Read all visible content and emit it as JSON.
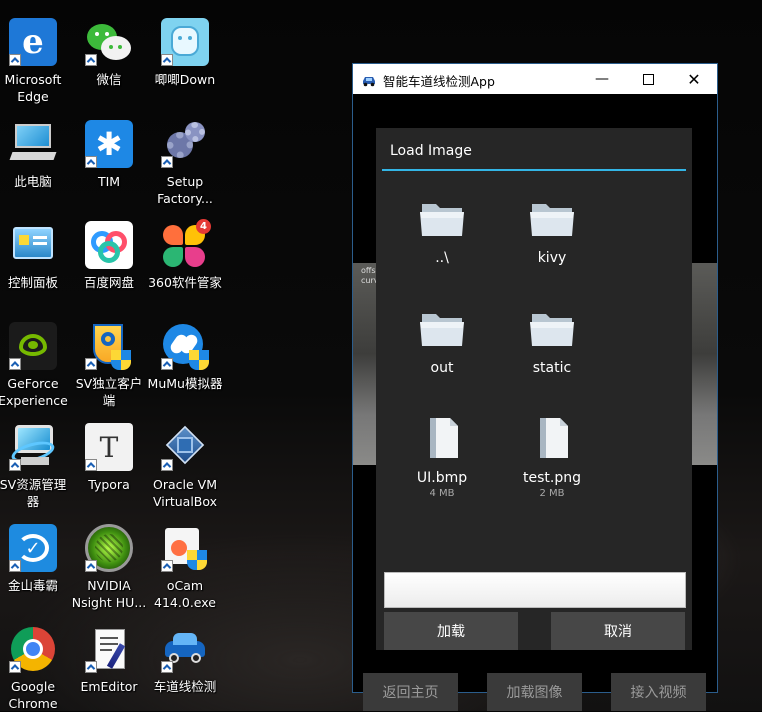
{
  "desktop": {
    "icons": [
      {
        "label": "Microsoft Edge",
        "icon": "edge-icon"
      },
      {
        "label": "微信",
        "icon": "wechat-icon"
      },
      {
        "label": "唧唧Down",
        "icon": "jijidown-icon"
      },
      {
        "label": "此电脑",
        "icon": "this-pc-icon"
      },
      {
        "label": "TIM",
        "icon": "tim-icon"
      },
      {
        "label": "Setup Factory...",
        "icon": "setup-factory-icon"
      },
      {
        "label": "控制面板",
        "icon": "control-panel-icon"
      },
      {
        "label": "百度网盘",
        "icon": "baidu-netdisk-icon"
      },
      {
        "label": "360软件管家",
        "icon": "360-software-icon",
        "badge": "4"
      },
      {
        "label": "GeForce Experience",
        "icon": "geforce-icon"
      },
      {
        "label": "SV独立客户端",
        "icon": "sv-client-icon"
      },
      {
        "label": "MuMu模拟器",
        "icon": "mumu-icon"
      },
      {
        "label": "SV资源管理器",
        "icon": "sv-explorer-icon"
      },
      {
        "label": "Typora",
        "icon": "typora-icon"
      },
      {
        "label": "Oracle VM VirtualBox",
        "icon": "virtualbox-icon"
      },
      {
        "label": "金山毒霸",
        "icon": "kingsoft-antivirus-icon"
      },
      {
        "label": "NVIDIA Nsight HU...",
        "icon": "nsight-icon"
      },
      {
        "label": "oCam 414.0.exe",
        "icon": "ocam-icon"
      },
      {
        "label": "Google Chrome",
        "icon": "chrome-icon"
      },
      {
        "label": "EmEditor",
        "icon": "emeditor-icon"
      },
      {
        "label": "车道线检测",
        "icon": "lane-detect-icon"
      }
    ]
  },
  "window": {
    "title": "智能车道线检测App",
    "bg_text_1": "offs",
    "bg_text_2": "curv",
    "bottom_buttons": [
      "返回主页",
      "加载图像",
      "接入视频"
    ]
  },
  "popup": {
    "title": "Load Image",
    "accent_color": "#33b5e5",
    "files": [
      {
        "name": "..\\",
        "type": "folder",
        "size": ""
      },
      {
        "name": "kivy",
        "type": "folder",
        "size": ""
      },
      {
        "name": "out",
        "type": "folder",
        "size": ""
      },
      {
        "name": "static",
        "type": "folder",
        "size": ""
      },
      {
        "name": "UI.bmp",
        "type": "file",
        "size": "4 MB"
      },
      {
        "name": "test.png",
        "type": "file",
        "size": "2 MB"
      }
    ],
    "filename_value": "",
    "load_button": "加载",
    "cancel_button": "取消"
  }
}
